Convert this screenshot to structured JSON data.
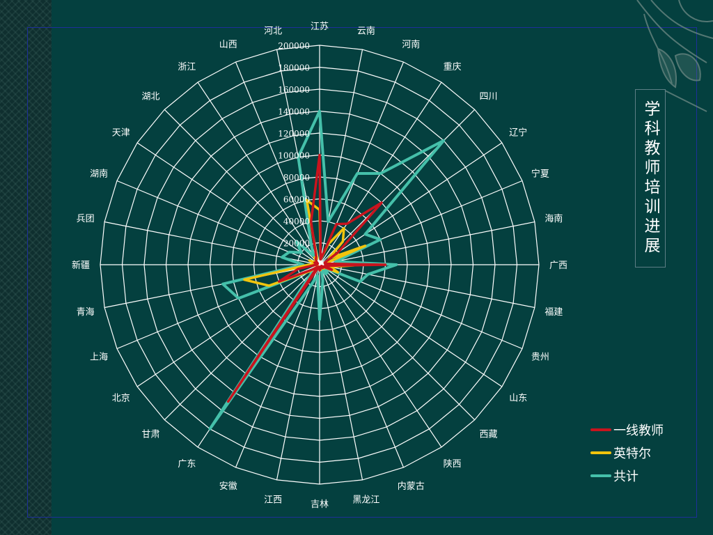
{
  "title": "学科教师培训进展",
  "colors": {
    "background": "#04403f",
    "grid": "#ffffff",
    "frame": "#1e2f9a",
    "title_border": "#5e7f86"
  },
  "chart_data": {
    "type": "radar",
    "categories": [
      "江苏",
      "云南",
      "河南",
      "重庆",
      "四川",
      "辽宁",
      "宁夏",
      "海南",
      "广西",
      "福建",
      "贵州",
      "山东",
      "西藏",
      "陕西",
      "内蒙古",
      "黑龙江",
      "吉林",
      "江西",
      "安徽",
      "广东",
      "甘肃",
      "北京",
      "上海",
      "青海",
      "新疆",
      "兵团",
      "湖南",
      "天津",
      "湖北",
      "浙江",
      "山西",
      "河北"
    ],
    "radial_ticks": [
      20000,
      40000,
      60000,
      80000,
      100000,
      120000,
      140000,
      160000,
      180000,
      200000
    ],
    "radial_range": [
      0,
      200000
    ],
    "grid": true,
    "legend_position": "right",
    "series": [
      {
        "name": "一线教师",
        "color": "#c8141e",
        "values": [
          100000,
          5000,
          40000,
          45000,
          80000,
          20000,
          5000,
          5000,
          60000,
          5000,
          12000,
          2000,
          4000,
          3000,
          2000,
          4000,
          5000,
          2000,
          2000,
          150000,
          3000,
          8000,
          40000,
          20000,
          3000,
          2000,
          5000,
          2000,
          4000,
          6000,
          8000,
          40000
        ]
      },
      {
        "name": "英特尔",
        "color": "#f2c40d",
        "values": [
          50000,
          5000,
          20000,
          40000,
          30000,
          10000,
          45000,
          5000,
          40000,
          10000,
          18000,
          3000,
          5000,
          2000,
          2000,
          5000,
          5000,
          2000,
          2000,
          20000,
          2000,
          10000,
          50000,
          70000,
          10000,
          3000,
          10000,
          3000,
          5000,
          8000,
          6000,
          60000
        ]
      },
      {
        "name": "共计",
        "color": "#45c0aa",
        "values": [
          140000,
          40000,
          90000,
          100000,
          160000,
          50000,
          60000,
          15000,
          70000,
          45000,
          40000,
          5000,
          10000,
          10000,
          5000,
          15000,
          50000,
          10000,
          20000,
          180000,
          10000,
          10000,
          80000,
          90000,
          15000,
          35000,
          30000,
          20000,
          30000,
          10000,
          20000,
          100000
        ]
      }
    ]
  }
}
